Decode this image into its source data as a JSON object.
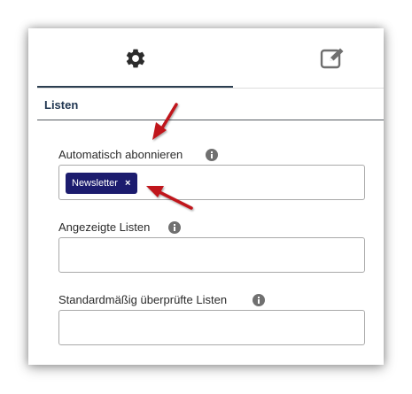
{
  "tabs": [
    {
      "icon": "gear-icon",
      "active": true
    },
    {
      "icon": "edit-icon",
      "active": false
    }
  ],
  "section": {
    "title": "Listen"
  },
  "fields": {
    "auto_subscribe": {
      "label": "Automatisch abonnieren",
      "tags": [
        "Newsletter"
      ],
      "tag_remove": "×"
    },
    "displayed_lists": {
      "label": "Angezeigte Listen"
    },
    "default_checked": {
      "label": "Standardmäßig überprüfte Listen"
    }
  },
  "colors": {
    "accent": "#2c3e50",
    "tag_bg": "#1c1c6e",
    "annotation_arrow": "#c0161b"
  }
}
